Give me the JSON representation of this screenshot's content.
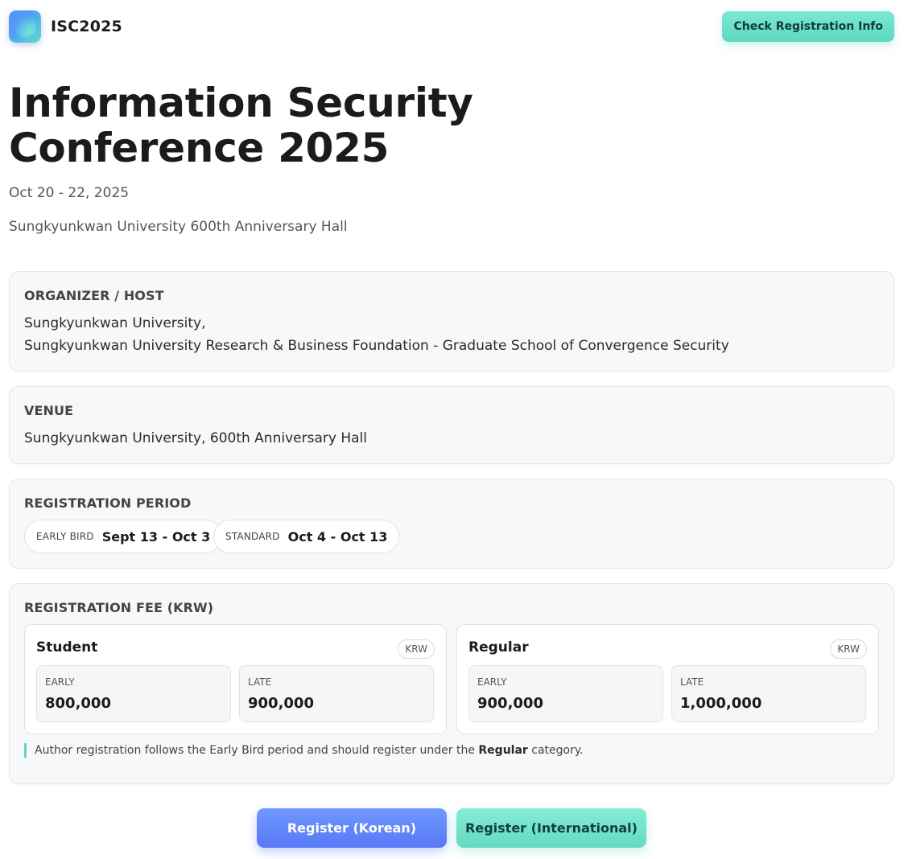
{
  "header": {
    "brand": "ISC2025",
    "check_button": "Check Registration Info"
  },
  "hero": {
    "title_line1": "Information Security",
    "title_line2": "Conference 2025",
    "date": "Oct 20 - 22, 2025",
    "venue": "Sungkyunkwan University 600th Anniversary Hall"
  },
  "organizer": {
    "label": "ORGANIZER / HOST",
    "line1": "Sungkyunkwan University,",
    "line2": "Sungkyunkwan University Research & Business Foundation - Graduate School of Convergence Security"
  },
  "venue": {
    "label": "VENUE",
    "text": "Sungkyunkwan University, 600th Anniversary Hall"
  },
  "period": {
    "label": "REGISTRATION PERIOD",
    "early_tag": "EARLY BIRD",
    "early_val": "Sept 13 - Oct 3",
    "standard_tag": "STANDARD",
    "standard_val": "Oct 4 - Oct 13"
  },
  "fee": {
    "label": "REGISTRATION FEE (KRW)",
    "student": {
      "title": "Student",
      "chip": "KRW",
      "early_tag": "EARLY",
      "early_val": "800,000",
      "late_tag": "LATE",
      "late_val": "900,000"
    },
    "regular": {
      "title": "Regular",
      "chip": "KRW",
      "early_tag": "EARLY",
      "early_val": "900,000",
      "late_tag": "LATE",
      "late_val": "1,000,000"
    },
    "note_pre": "Author registration follows the Early Bird period and should register under the ",
    "note_bold": "Regular",
    "note_post": " category."
  },
  "actions": {
    "register_korean": "Register (Korean)",
    "register_international": "Register (International)"
  },
  "colors": {
    "accent_teal": "#5fd8c0",
    "accent_blue": "#5878f5"
  }
}
